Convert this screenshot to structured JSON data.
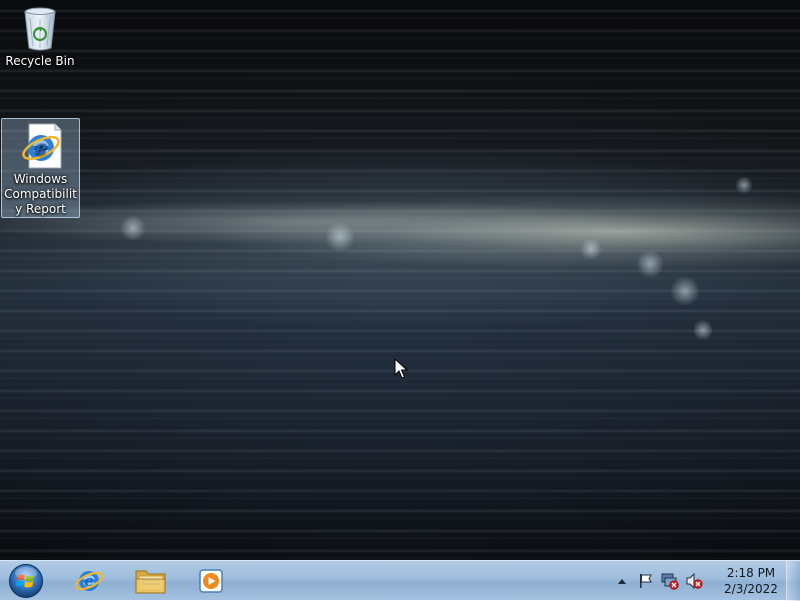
{
  "desktop": {
    "icons": [
      {
        "label": "Recycle Bin",
        "icon": "recycle-bin-icon",
        "selected": false
      },
      {
        "label": "Windows Compatibility Report",
        "icon": "internet-explorer-document-icon",
        "selected": true
      }
    ]
  },
  "taskbar": {
    "start_icon": "windows-orb-icon",
    "pinned": [
      {
        "name": "Internet Explorer",
        "icon": "internet-explorer-icon"
      },
      {
        "name": "Windows Explorer",
        "icon": "folder-icon"
      },
      {
        "name": "Windows Media Player",
        "icon": "media-player-icon"
      }
    ],
    "tray": {
      "icons": [
        "show-hidden-icons-arrow",
        "action-center-flag-icon",
        "network-disconnected-icon",
        "volume-muted-icon"
      ],
      "time": "2:18 PM",
      "date": "2/3/2022"
    },
    "colors": {
      "taskbar": "#a4c1e0",
      "clock_text": "#101820"
    }
  }
}
